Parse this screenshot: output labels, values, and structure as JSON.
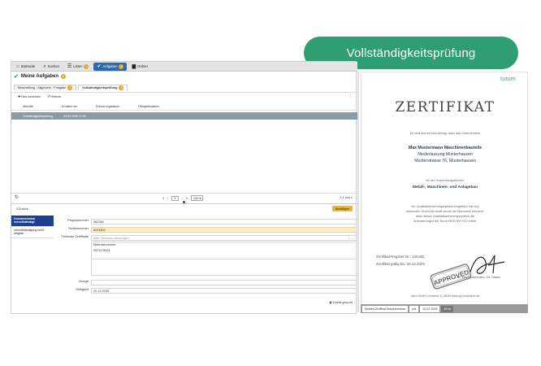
{
  "pill": {
    "label": "Vollständigkeitsprüfung"
  },
  "topbar": {
    "items": [
      {
        "label": "Startseite",
        "icon": "home-icon"
      },
      {
        "label": "Suchen",
        "icon": "search-icon"
      },
      {
        "label": "Listen",
        "icon": "list-icon",
        "badge": "1"
      },
      {
        "label": "Aufgaben",
        "icon": "check-icon",
        "badge": "3"
      },
      {
        "label": "Ordner",
        "icon": "folder-icon"
      }
    ]
  },
  "page": {
    "title": "Meine Aufgaben",
    "badge": "2"
  },
  "tabs": [
    {
      "label": "Beschaffung · Allgemein · Freigabe",
      "badge": "1"
    },
    {
      "label": "Vollständigkeitsprüfung",
      "badge": "1"
    }
  ],
  "toolbar": {
    "new_label": "Neu zuweisen",
    "history_label": "Historie",
    "more": "⋮"
  },
  "table": {
    "headers": [
      "Aktivität",
      "Erhalten am",
      "Erinnerungsdatum",
      "Fälligkeitsdatum"
    ],
    "rows": [
      {
        "activity": "Vollständigkeitsprüfung",
        "received": "25.02.2025 17:03",
        "reminder": "",
        "due": ""
      }
    ]
  },
  "pager": {
    "prev2": "«",
    "prev": "‹",
    "page": "1",
    "next": "›",
    "next2": "»",
    "page_size": "100",
    "count": "1-1 von 1"
  },
  "lower": {
    "back_label": "Zurück",
    "confirm_label": "Bestätigen",
    "nav": [
      {
        "label": "Dokumentation vervollständigt",
        "active": true
      },
      {
        "label": "Vervollständigung nicht möglich",
        "active": false
      }
    ],
    "fields": {
      "project_label": "Projektnummer",
      "project_value": "982345",
      "serial_label": "Seriennummer",
      "serial_value": "8251602",
      "missing_label": "Fehlende Zertifikate",
      "missing_placeholder": "Bitte Zeichnen hinzufügen",
      "mat_header": "Materialnummer",
      "mat_value": "0021178001",
      "charge_label": "Charge",
      "charge_value": "",
      "valid_label": "Gültigkeit",
      "valid_value": "20.12.2025"
    },
    "footer": "Zuletzt gesucht"
  },
  "certificate": {
    "logo": "tutum",
    "title": "Zertifikat",
    "intro": "Es wird hiermit bescheinigt, dass das Unternehmen",
    "company": "Max Mustermann Maschinenbauteile",
    "branch": "Niederlassung Musterhausen",
    "address": "Musterstrasse 76, Musterhausen",
    "scope_intro": "für den Anwendungsbereich",
    "scope": "Metall-, Maschinen- und Anlagebau",
    "text1": "ein Qualitätssicherungssystem eingeführt hat und",
    "text2": "anwendet. Durch ein Audit wurde der Nachweis erbracht,",
    "text3": "dass dieses Qualitätssicherungssystem die",
    "text4": "Anforderungen der Norm MUSTER ISO erfüllt.",
    "reg_label": "Zertifikat-Register-Nr.: 12543E",
    "valid_label": "Zertifikat gültig bis: 20.12.2025",
    "stamp": "APPROVED",
    "signer": "Dr. Max Mustermann, Ort, Datum",
    "footer": "tutum GmbH | Gerberstr. 4 | 35039 Marburg | www.tutum.de"
  },
  "cert_bar": [
    "Muster-Zertifikat Maschinenbau",
    "pdf",
    "20.02.2025",
    "48 kb"
  ],
  "colors": {
    "accent": "#2d6ab0",
    "pill": "#2f9f73",
    "confirm": "#f0b52b",
    "nav_active": "#1f3f8f"
  }
}
